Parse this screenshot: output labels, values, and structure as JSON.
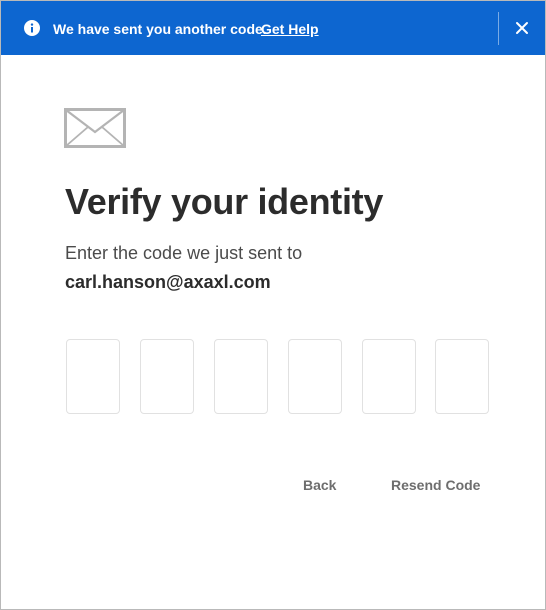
{
  "banner": {
    "message": "We have sent you another code.",
    "link_label": "Get Help",
    "icon": "info-icon",
    "close_icon": "close-icon",
    "background_color": "#0d66d0"
  },
  "main": {
    "icon": "envelope-icon",
    "title": "Verify your identity",
    "subtitle": "Enter the code we just sent to",
    "email": "carl.hanson@axaxl.com",
    "code_digits": [
      "",
      "",
      "",
      "",
      "",
      ""
    ]
  },
  "actions": {
    "back_label": "Back",
    "resend_label": "Resend Code"
  }
}
